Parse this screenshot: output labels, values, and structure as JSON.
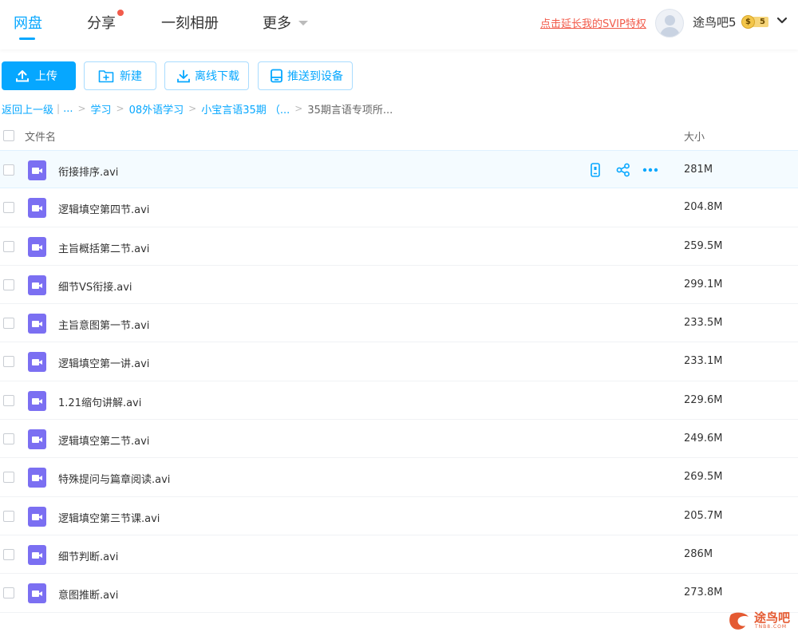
{
  "nav": {
    "tabs": [
      {
        "label": "网盘",
        "active": true
      },
      {
        "label": "分享",
        "has_dot": true
      },
      {
        "label": "一刻相册"
      },
      {
        "label": "更多",
        "has_caret": true
      }
    ],
    "svip_link": "点击延长我的SVIP特权",
    "username": "途鸟吧5",
    "vip_level": "5",
    "vip_coin": "$",
    "icons": {
      "avatar": "avatar-icon",
      "chevron": "chevron-down-icon"
    }
  },
  "toolbar": {
    "upload": "上传",
    "new": "新建",
    "offline_download": "离线下载",
    "push_device": "推送到设备"
  },
  "breadcrumb": {
    "back": "返回上一级",
    "sep_pipe": "|",
    "ellipsis": "...",
    "items": [
      "学习",
      "08外语学习",
      "小宝言语35期 （..."
    ],
    "current": "35期言语专项所..."
  },
  "table": {
    "col_name": "文件名",
    "col_size": "大小"
  },
  "files": [
    {
      "name": "衔接排序.avi",
      "size": "281M"
    },
    {
      "name": "逻辑填空第四节.avi",
      "size": "204.8M"
    },
    {
      "name": "主旨概括第二节.avi",
      "size": "259.5M"
    },
    {
      "name": "细节VS衔接.avi",
      "size": "299.1M"
    },
    {
      "name": "主旨意图第一节.avi",
      "size": "233.5M"
    },
    {
      "name": "逻辑填空第一讲.avi",
      "size": "233.1M"
    },
    {
      "name": "1.21缩句讲解.avi",
      "size": "229.6M"
    },
    {
      "name": "逻辑填空第二节.avi",
      "size": "249.6M"
    },
    {
      "name": "特殊提问与篇章阅读.avi",
      "size": "269.5M"
    },
    {
      "name": "逻辑填空第三节课.avi",
      "size": "205.7M"
    },
    {
      "name": "细节判断.avi",
      "size": "286M"
    },
    {
      "name": "意图推断.avi",
      "size": "273.8M"
    }
  ],
  "colors": {
    "accent": "#06a7ff",
    "danger": "#f25b4b",
    "video_icon": "#7b6ff2"
  },
  "watermark": {
    "text": "途鸟吧",
    "sub": "TNB8.COM"
  }
}
